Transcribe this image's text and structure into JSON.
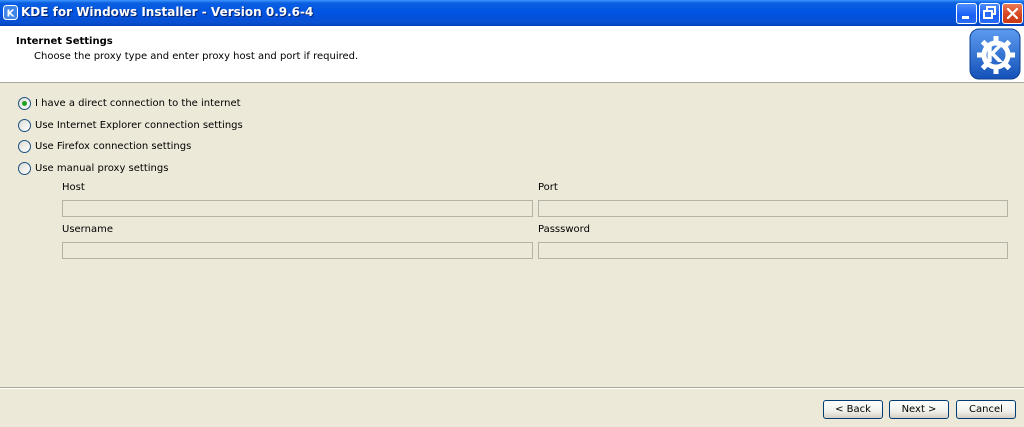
{
  "window": {
    "title": "KDE for Windows Installer - Version 0.9.6-4"
  },
  "header": {
    "title": "Internet Settings",
    "subtitle": "Choose the proxy type and enter proxy host and port if required."
  },
  "options": [
    {
      "label": "I have a direct connection to the internet",
      "checked": true
    },
    {
      "label": "Use Internet Explorer connection settings",
      "checked": false
    },
    {
      "label": "Use Firefox connection settings",
      "checked": false
    },
    {
      "label": "Use manual proxy settings",
      "checked": false
    }
  ],
  "fields": {
    "host_label": "Host",
    "host_value": "",
    "port_label": "Port",
    "port_value": "",
    "username_label": "Username",
    "username_value": "",
    "password_label": "Passsword",
    "password_value": ""
  },
  "buttons": {
    "back": "< Back",
    "next": "Next >",
    "cancel": "Cancel"
  },
  "icons": {
    "app": "kde-icon",
    "logo": "kde-logo",
    "minimize": "minimize-icon",
    "restore": "restore-icon",
    "close": "close-icon"
  },
  "colors": {
    "titlebar": "#0054e3",
    "background": "#ece9d8",
    "radio_checked": "#21a121",
    "kde_blue": "#1d66d1"
  }
}
